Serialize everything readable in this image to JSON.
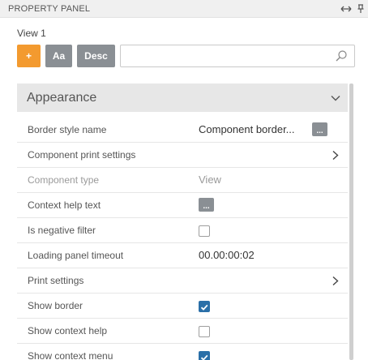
{
  "panel": {
    "title": "PROPERTY PANEL"
  },
  "view": {
    "label": "View 1"
  },
  "toolbar": {
    "add_label": "+",
    "aa_label": "Aa",
    "desc_label": "Desc"
  },
  "search": {
    "value": "",
    "placeholder": ""
  },
  "section": {
    "title": "Appearance",
    "expanded": true
  },
  "colors": {
    "accent": "#f39a2f",
    "button_gray": "#8a8f94",
    "checkbox_blue": "#2a6fa8"
  },
  "properties": [
    {
      "label": "Border style name",
      "value": "Component border...",
      "kind": "text-with-ellipsis"
    },
    {
      "label": "Component print settings",
      "kind": "expandable"
    },
    {
      "label": "Component type",
      "value": "View",
      "kind": "readonly"
    },
    {
      "label": "Context help text",
      "kind": "ellipsis"
    },
    {
      "label": "Is negative filter",
      "kind": "checkbox",
      "checked": false
    },
    {
      "label": "Loading panel timeout",
      "value": "00.00:00:02",
      "kind": "text"
    },
    {
      "label": "Print settings",
      "kind": "expandable"
    },
    {
      "label": "Show border",
      "kind": "checkbox",
      "checked": true
    },
    {
      "label": "Show context help",
      "kind": "checkbox",
      "checked": false
    },
    {
      "label": "Show context menu",
      "kind": "checkbox",
      "checked": true
    }
  ],
  "ellipsis_label": "..."
}
